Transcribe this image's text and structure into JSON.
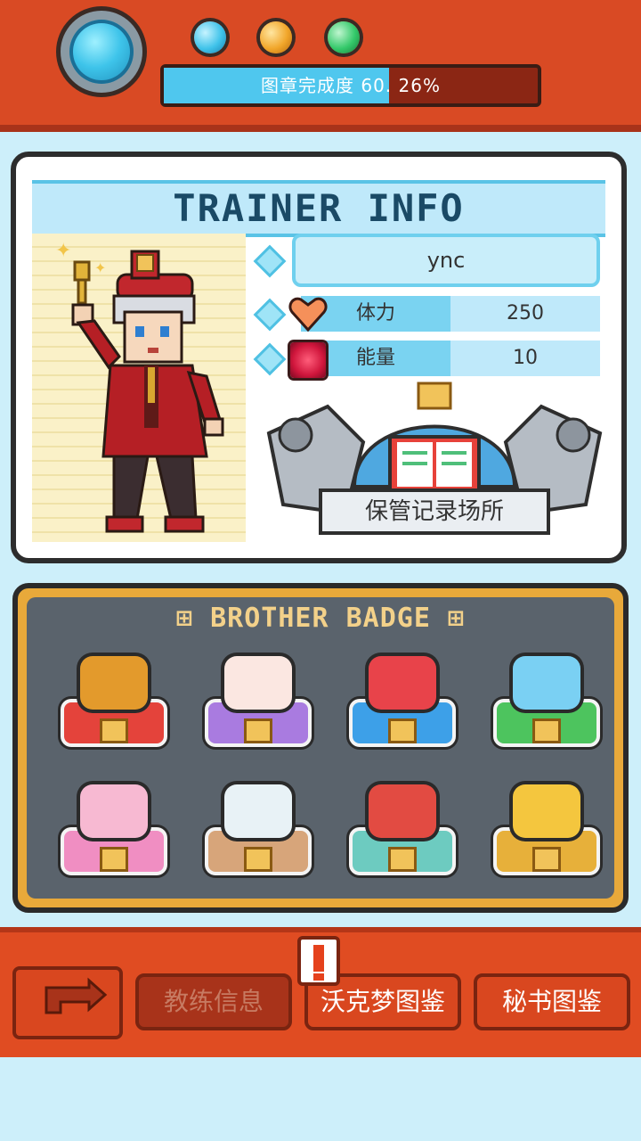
{
  "header": {
    "progress_label": "图章完成度",
    "progress_value": "60. 26%",
    "progress_fraction": 0.6026,
    "dots": [
      {
        "name": "blue-gem-icon",
        "color": "#3fc3ea"
      },
      {
        "name": "orange-gem-icon",
        "color": "#f1a62a"
      },
      {
        "name": "green-gem-icon",
        "color": "#34c96a"
      }
    ]
  },
  "trainer": {
    "title": "TRAINER INFO",
    "name": "ync",
    "stats": [
      {
        "label": "体力",
        "value": "250",
        "icon": "heart-icon"
      },
      {
        "label": "能量",
        "value": "10",
        "icon": "red-gem-icon"
      }
    ],
    "location": "保管记录场所"
  },
  "badges": {
    "title": "⊞ BROTHER BADGE ⊞",
    "items": [
      {
        "name": "croissant-badge",
        "top": "#e39a2c",
        "base": "#e4433b"
      },
      {
        "name": "cake-badge",
        "top": "#fbe7e1",
        "base": "#a97be0"
      },
      {
        "name": "basket-badge",
        "top": "#e8434a",
        "base": "#3da0e8"
      },
      {
        "name": "castle-badge",
        "top": "#7ad0f3",
        "base": "#4dc45e"
      },
      {
        "name": "hotel-badge",
        "top": "#f7b9d2",
        "base": "#f08ec2"
      },
      {
        "name": "chart-badge",
        "top": "#e8f2f6",
        "base": "#d7a57a"
      },
      {
        "name": "ship-badge",
        "top": "#e24b42",
        "base": "#6dcbc0"
      },
      {
        "name": "gold-bar-badge",
        "top": "#f4c63e",
        "base": "#e7b03a"
      }
    ]
  },
  "nav": {
    "tabs": [
      "教练信息",
      "沃克梦图鉴",
      "秘书图鉴"
    ]
  }
}
